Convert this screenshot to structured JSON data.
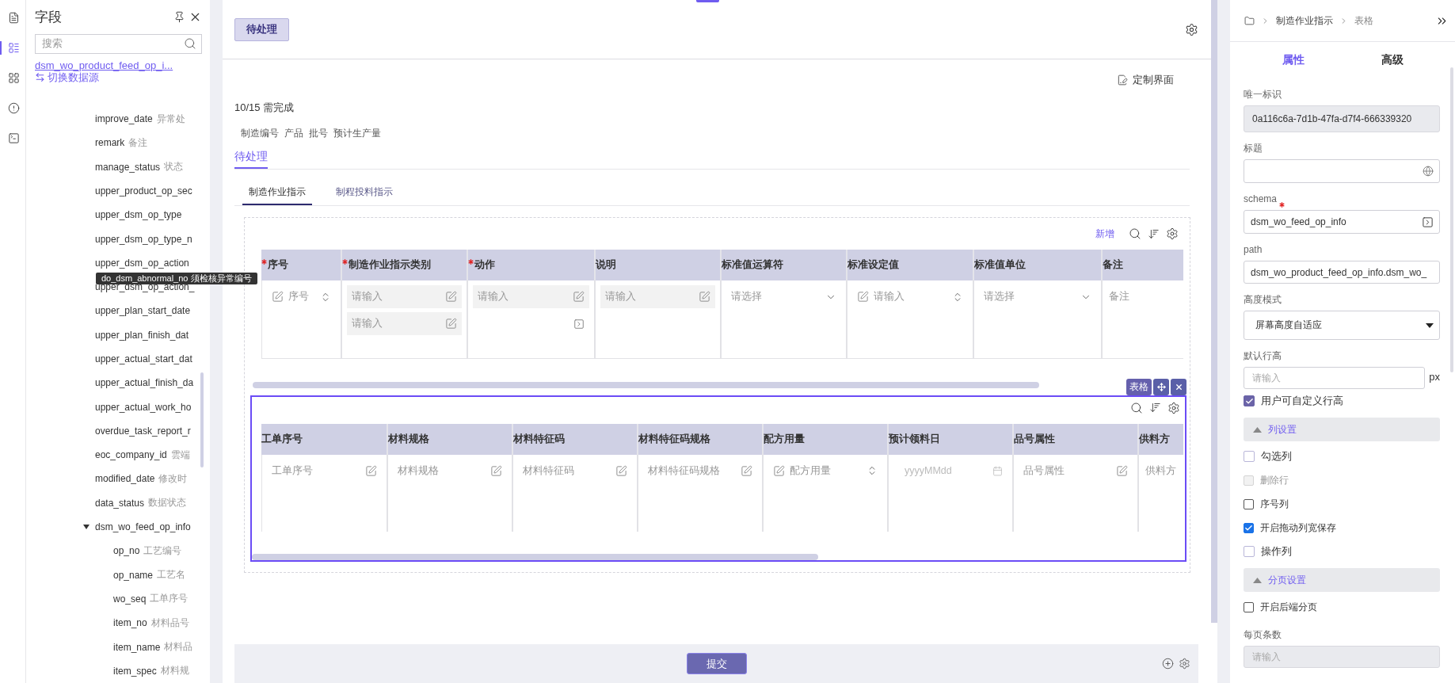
{
  "rail": {
    "items": [
      {
        "selected": false
      },
      {
        "selected": true
      },
      {
        "selected": false
      },
      {
        "selected": false
      },
      {
        "selected": false
      }
    ]
  },
  "field_panel": {
    "title": "字段",
    "search": {
      "placeholder": "搜索"
    },
    "datasource": {
      "name": "dsm_wo_product_feed_op_i...",
      "action": "切换数据源"
    },
    "items": [
      {
        "name": "improve_date",
        "desc": "异常处"
      },
      {
        "name": "remark",
        "desc": "备注"
      },
      {
        "name": "manage_status",
        "desc": "状态"
      },
      {
        "name": "upper_product_op_sec"
      },
      {
        "name": "upper_dsm_op_type"
      },
      {
        "name": "upper_dsm_op_type_n"
      },
      {
        "name": "upper_dsm_op_action"
      },
      {
        "name": "upper_dsm_op_action_"
      },
      {
        "name": "upper_plan_start_date"
      },
      {
        "name": "upper_plan_finish_dat"
      },
      {
        "name": "upper_actual_start_dat"
      },
      {
        "name": "upper_actual_finish_da"
      },
      {
        "name": "upper_actual_work_ho"
      },
      {
        "name": "overdue_task_report_r"
      },
      {
        "name": "eoc_company_id",
        "desc": "雲端"
      },
      {
        "name": "modified_date",
        "desc": "修改时"
      },
      {
        "name": "data_status",
        "desc": "数据状态"
      },
      {
        "name": "dsm_wo_feed_op_info",
        "expanded": true,
        "children": [
          {
            "name": "op_no",
            "desc": "工艺编号"
          },
          {
            "name": "op_name",
            "desc": "工艺名"
          },
          {
            "name": "wo_seq",
            "desc": "工单序号"
          },
          {
            "name": "item_no",
            "desc": "材料品号"
          },
          {
            "name": "item_name",
            "desc": "材料品"
          },
          {
            "name": "item_spec",
            "desc": "材料规"
          }
        ]
      }
    ]
  },
  "tooltip": {
    "text": "do_dsm_abnormal_no 须检核异常编号"
  },
  "header": {
    "tab": {
      "label": "待处理",
      "selected": true
    }
  },
  "customize": "定制界面",
  "progress_text": "10/15 需完成",
  "summary_fields": [
    "制造编号",
    "产品",
    "批号",
    "预计生产量"
  ],
  "status_tabs": [
    {
      "label": "待处理",
      "selected": true
    }
  ],
  "sub_tabs": [
    {
      "label": "制造作业指示",
      "selected": true
    },
    {
      "label": "制程投料指示",
      "selected": false
    }
  ],
  "table_1": {
    "add_label": "新增",
    "columns": [
      {
        "header": "序号",
        "required": true,
        "cells": [
          {
            "kind": "number",
            "placeholder": "序号"
          }
        ]
      },
      {
        "header": "制造作业指示类别",
        "required": true,
        "cells": [
          {
            "kind": "input",
            "placeholder": "请输入"
          },
          {
            "kind": "input",
            "placeholder": "请输入"
          }
        ]
      },
      {
        "header": "动作",
        "required": true,
        "cells": [
          {
            "kind": "input",
            "placeholder": "请输入"
          },
          {
            "kind": "picker"
          }
        ]
      },
      {
        "header": "说明",
        "required": false,
        "cells": [
          {
            "kind": "input",
            "placeholder": "请输入"
          }
        ]
      },
      {
        "header": "标准值运算符",
        "required": false,
        "cells": [
          {
            "kind": "select",
            "placeholder": "请选择"
          }
        ]
      },
      {
        "header": "标准设定值",
        "required": false,
        "cells": [
          {
            "kind": "number",
            "placeholder": "请输入"
          }
        ]
      },
      {
        "header": "标准值单位",
        "required": false,
        "cells": [
          {
            "kind": "select",
            "placeholder": "请选择"
          }
        ]
      },
      {
        "header": "备注",
        "required": false,
        "cells": [
          {
            "kind": "text",
            "placeholder": "备注"
          }
        ]
      }
    ]
  },
  "table_2": {
    "selected": true,
    "badge": "表格",
    "columns": [
      {
        "header": "工单序号",
        "required": false,
        "cells": [
          {
            "kind": "edit",
            "placeholder": "工单序号"
          }
        ]
      },
      {
        "header": "材料规格",
        "required": false,
        "cells": [
          {
            "kind": "edit",
            "placeholder": "材料规格"
          }
        ]
      },
      {
        "header": "材料特征码",
        "required": false,
        "cells": [
          {
            "kind": "edit",
            "placeholder": "材料特征码"
          }
        ]
      },
      {
        "header": "材料特征码规格",
        "required": false,
        "cells": [
          {
            "kind": "edit",
            "placeholder": "材料特征码规格"
          }
        ]
      },
      {
        "header": "配方用量",
        "required": false,
        "cells": [
          {
            "kind": "number",
            "placeholder": "配方用量"
          }
        ]
      },
      {
        "header": "预计领料日",
        "required": false,
        "cells": [
          {
            "kind": "date",
            "placeholder": "yyyyMMdd"
          }
        ]
      },
      {
        "header": "品号属性",
        "required": false,
        "cells": [
          {
            "kind": "edit",
            "placeholder": "品号属性"
          }
        ]
      },
      {
        "header": "供料方",
        "required": false,
        "cells": [
          {
            "kind": "text",
            "placeholder": "供料方"
          }
        ]
      }
    ]
  },
  "footer": {
    "submit": "提交"
  },
  "properties": {
    "breadcrumb": [
      "制造作业指示",
      "表格"
    ],
    "tabs": [
      {
        "label": "属性",
        "selected": true
      },
      {
        "label": "高级",
        "selected": false
      }
    ],
    "items": [
      {
        "kind": "readonly",
        "label": "唯一标识",
        "value": "0a116c6a-7d1b-47fa-d7f4-666339320"
      },
      {
        "kind": "globe-input",
        "label": "标题"
      },
      {
        "kind": "picker-input",
        "label": "schema",
        "required": true,
        "value": "dsm_wo_feed_op_info"
      },
      {
        "kind": "input",
        "label": "path",
        "value": "dsm_wo_product_feed_op_info.dsm_wo_"
      },
      {
        "kind": "select",
        "label": "高度模式",
        "value": "屏幕高度自适应"
      },
      {
        "kind": "unit-input",
        "label": "默认行高",
        "placeholder": "请输入",
        "unit": "px"
      },
      {
        "kind": "checkbox",
        "label": "用户可自定义行高",
        "checked": true,
        "disabled": false,
        "color": "#6b64a8"
      },
      {
        "kind": "section",
        "label": "列设置",
        "expanded": true
      },
      {
        "kind": "checkbox",
        "label": "勾选列",
        "checked": false,
        "disabled": false,
        "color": "#b9b6d9"
      },
      {
        "kind": "checkbox",
        "label": "删除行",
        "checked": false,
        "disabled": true,
        "color": "#d4d4d4"
      },
      {
        "kind": "checkbox",
        "label": "序号列",
        "checked": false,
        "disabled": false,
        "color": "#555555"
      },
      {
        "kind": "checkbox",
        "label": "开启拖动列宽保存",
        "checked": true,
        "disabled": false,
        "color": "#1a73e8"
      },
      {
        "kind": "checkbox",
        "label": "操作列",
        "checked": false,
        "disabled": false,
        "color": "#b9b6d9"
      },
      {
        "kind": "section",
        "label": "分页设置",
        "expanded": true
      },
      {
        "kind": "checkbox",
        "label": "开启后端分页",
        "checked": false,
        "disabled": false,
        "color": "#555555"
      },
      {
        "kind": "disabled-input",
        "label": "每页条数",
        "placeholder": "请输入"
      }
    ]
  }
}
